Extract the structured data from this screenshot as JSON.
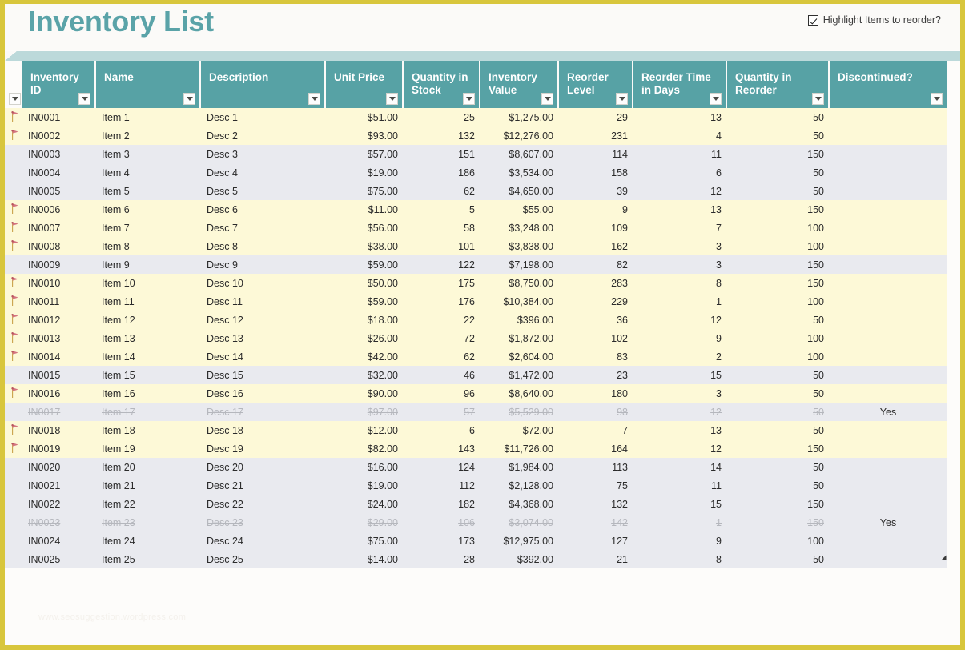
{
  "page": {
    "title": "Inventory List",
    "watermark": "www.seosuggestion.wordpress.com",
    "accent_teal": "#57a2a5",
    "title_teal": "#5aa3a8",
    "border_gold": "#d8c63c",
    "row_highlight_yellow": "#fdf9d7",
    "row_stripe_gray": "#e9eaef"
  },
  "toggle": {
    "label": "Highlight Items to reorder?",
    "checked": true
  },
  "table": {
    "columns": [
      "Inventory ID",
      "Name",
      "Description",
      "Unit Price",
      "Quantity in Stock",
      "Inventory Value",
      "Reorder Level",
      "Reorder Time in Days",
      "Quantity in Reorder",
      "Discontinued?"
    ],
    "rows": [
      {
        "id": "IN0001",
        "name": "Item 1",
        "desc": "Desc 1",
        "price": "$51.00",
        "stock": "25",
        "value": "$1,275.00",
        "reorder_level": "29",
        "reorder_days": "13",
        "qty_reorder": "50",
        "discontinued": "",
        "flag": true,
        "band": "yellow"
      },
      {
        "id": "IN0002",
        "name": "Item 2",
        "desc": "Desc 2",
        "price": "$93.00",
        "stock": "132",
        "value": "$12,276.00",
        "reorder_level": "231",
        "reorder_days": "4",
        "qty_reorder": "50",
        "discontinued": "",
        "flag": true,
        "band": "yellow"
      },
      {
        "id": "IN0003",
        "name": "Item 3",
        "desc": "Desc 3",
        "price": "$57.00",
        "stock": "151",
        "value": "$8,607.00",
        "reorder_level": "114",
        "reorder_days": "11",
        "qty_reorder": "150",
        "discontinued": "",
        "flag": false,
        "band": "gray"
      },
      {
        "id": "IN0004",
        "name": "Item 4",
        "desc": "Desc 4",
        "price": "$19.00",
        "stock": "186",
        "value": "$3,534.00",
        "reorder_level": "158",
        "reorder_days": "6",
        "qty_reorder": "50",
        "discontinued": "",
        "flag": false,
        "band": "gray"
      },
      {
        "id": "IN0005",
        "name": "Item 5",
        "desc": "Desc 5",
        "price": "$75.00",
        "stock": "62",
        "value": "$4,650.00",
        "reorder_level": "39",
        "reorder_days": "12",
        "qty_reorder": "50",
        "discontinued": "",
        "flag": false,
        "band": "gray"
      },
      {
        "id": "IN0006",
        "name": "Item 6",
        "desc": "Desc 6",
        "price": "$11.00",
        "stock": "5",
        "value": "$55.00",
        "reorder_level": "9",
        "reorder_days": "13",
        "qty_reorder": "150",
        "discontinued": "",
        "flag": true,
        "band": "yellow"
      },
      {
        "id": "IN0007",
        "name": "Item 7",
        "desc": "Desc 7",
        "price": "$56.00",
        "stock": "58",
        "value": "$3,248.00",
        "reorder_level": "109",
        "reorder_days": "7",
        "qty_reorder": "100",
        "discontinued": "",
        "flag": true,
        "band": "yellow"
      },
      {
        "id": "IN0008",
        "name": "Item 8",
        "desc": "Desc 8",
        "price": "$38.00",
        "stock": "101",
        "value": "$3,838.00",
        "reorder_level": "162",
        "reorder_days": "3",
        "qty_reorder": "100",
        "discontinued": "",
        "flag": true,
        "band": "yellow"
      },
      {
        "id": "IN0009",
        "name": "Item 9",
        "desc": "Desc 9",
        "price": "$59.00",
        "stock": "122",
        "value": "$7,198.00",
        "reorder_level": "82",
        "reorder_days": "3",
        "qty_reorder": "150",
        "discontinued": "",
        "flag": false,
        "band": "gray"
      },
      {
        "id": "IN0010",
        "name": "Item 10",
        "desc": "Desc 10",
        "price": "$50.00",
        "stock": "175",
        "value": "$8,750.00",
        "reorder_level": "283",
        "reorder_days": "8",
        "qty_reorder": "150",
        "discontinued": "",
        "flag": true,
        "band": "yellow"
      },
      {
        "id": "IN0011",
        "name": "Item 11",
        "desc": "Desc 11",
        "price": "$59.00",
        "stock": "176",
        "value": "$10,384.00",
        "reorder_level": "229",
        "reorder_days": "1",
        "qty_reorder": "100",
        "discontinued": "",
        "flag": true,
        "band": "yellow"
      },
      {
        "id": "IN0012",
        "name": "Item 12",
        "desc": "Desc 12",
        "price": "$18.00",
        "stock": "22",
        "value": "$396.00",
        "reorder_level": "36",
        "reorder_days": "12",
        "qty_reorder": "50",
        "discontinued": "",
        "flag": true,
        "band": "yellow"
      },
      {
        "id": "IN0013",
        "name": "Item 13",
        "desc": "Desc 13",
        "price": "$26.00",
        "stock": "72",
        "value": "$1,872.00",
        "reorder_level": "102",
        "reorder_days": "9",
        "qty_reorder": "100",
        "discontinued": "",
        "flag": true,
        "band": "yellow"
      },
      {
        "id": "IN0014",
        "name": "Item 14",
        "desc": "Desc 14",
        "price": "$42.00",
        "stock": "62",
        "value": "$2,604.00",
        "reorder_level": "83",
        "reorder_days": "2",
        "qty_reorder": "100",
        "discontinued": "",
        "flag": true,
        "band": "yellow"
      },
      {
        "id": "IN0015",
        "name": "Item 15",
        "desc": "Desc 15",
        "price": "$32.00",
        "stock": "46",
        "value": "$1,472.00",
        "reorder_level": "23",
        "reorder_days": "15",
        "qty_reorder": "50",
        "discontinued": "",
        "flag": false,
        "band": "gray"
      },
      {
        "id": "IN0016",
        "name": "Item 16",
        "desc": "Desc 16",
        "price": "$90.00",
        "stock": "96",
        "value": "$8,640.00",
        "reorder_level": "180",
        "reorder_days": "3",
        "qty_reorder": "50",
        "discontinued": "",
        "flag": true,
        "band": "yellow"
      },
      {
        "id": "IN0017",
        "name": "Item 17",
        "desc": "Desc 17",
        "price": "$97.00",
        "stock": "57",
        "value": "$5,529.00",
        "reorder_level": "98",
        "reorder_days": "12",
        "qty_reorder": "50",
        "discontinued": "Yes",
        "flag": false,
        "band": "gray",
        "disc": true
      },
      {
        "id": "IN0018",
        "name": "Item 18",
        "desc": "Desc 18",
        "price": "$12.00",
        "stock": "6",
        "value": "$72.00",
        "reorder_level": "7",
        "reorder_days": "13",
        "qty_reorder": "50",
        "discontinued": "",
        "flag": true,
        "band": "yellow"
      },
      {
        "id": "IN0019",
        "name": "Item 19",
        "desc": "Desc 19",
        "price": "$82.00",
        "stock": "143",
        "value": "$11,726.00",
        "reorder_level": "164",
        "reorder_days": "12",
        "qty_reorder": "150",
        "discontinued": "",
        "flag": true,
        "band": "yellow"
      },
      {
        "id": "IN0020",
        "name": "Item 20",
        "desc": "Desc 20",
        "price": "$16.00",
        "stock": "124",
        "value": "$1,984.00",
        "reorder_level": "113",
        "reorder_days": "14",
        "qty_reorder": "50",
        "discontinued": "",
        "flag": false,
        "band": "gray"
      },
      {
        "id": "IN0021",
        "name": "Item 21",
        "desc": "Desc 21",
        "price": "$19.00",
        "stock": "112",
        "value": "$2,128.00",
        "reorder_level": "75",
        "reorder_days": "11",
        "qty_reorder": "50",
        "discontinued": "",
        "flag": false,
        "band": "gray"
      },
      {
        "id": "IN0022",
        "name": "Item 22",
        "desc": "Desc 22",
        "price": "$24.00",
        "stock": "182",
        "value": "$4,368.00",
        "reorder_level": "132",
        "reorder_days": "15",
        "qty_reorder": "150",
        "discontinued": "",
        "flag": false,
        "band": "gray"
      },
      {
        "id": "IN0023",
        "name": "Item 23",
        "desc": "Desc 23",
        "price": "$29.00",
        "stock": "106",
        "value": "$3,074.00",
        "reorder_level": "142",
        "reorder_days": "1",
        "qty_reorder": "150",
        "discontinued": "Yes",
        "flag": false,
        "band": "gray",
        "disc": true
      },
      {
        "id": "IN0024",
        "name": "Item 24",
        "desc": "Desc 24",
        "price": "$75.00",
        "stock": "173",
        "value": "$12,975.00",
        "reorder_level": "127",
        "reorder_days": "9",
        "qty_reorder": "100",
        "discontinued": "",
        "flag": false,
        "band": "gray"
      },
      {
        "id": "IN0025",
        "name": "Item 25",
        "desc": "Desc 25",
        "price": "$14.00",
        "stock": "28",
        "value": "$392.00",
        "reorder_level": "21",
        "reorder_days": "8",
        "qty_reorder": "50",
        "discontinued": "",
        "flag": false,
        "band": "gray"
      }
    ]
  }
}
